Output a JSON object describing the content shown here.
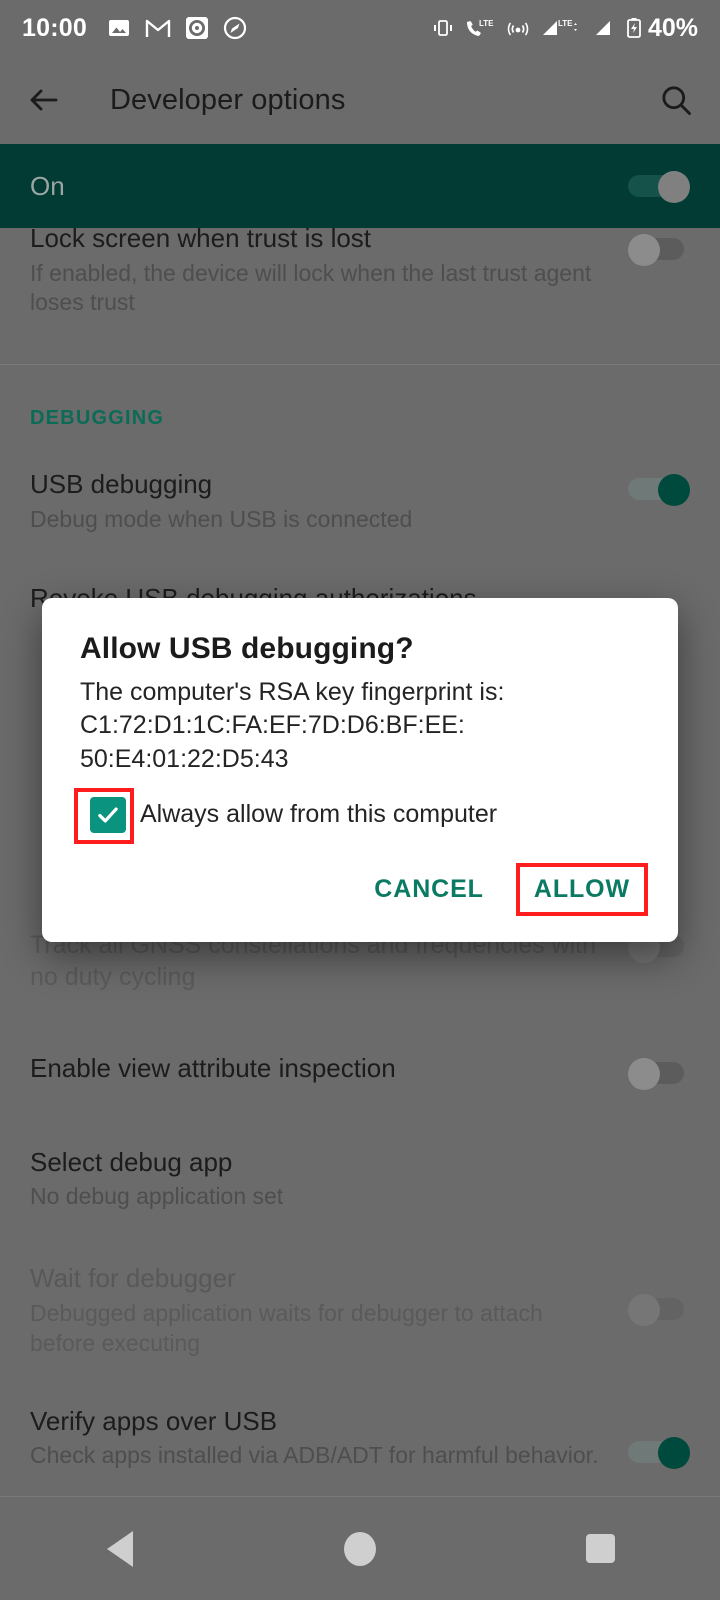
{
  "status_bar": {
    "time": "10:00",
    "battery_percent": "40%",
    "left_icons": [
      "photos-icon",
      "gmail-icon",
      "record-icon",
      "compass-icon"
    ],
    "right_icons": [
      "vibrate-icon",
      "call-lte-icon",
      "hotspot-icon",
      "signal-lte-icon",
      "signal-icon",
      "battery-charging-icon"
    ]
  },
  "app_bar": {
    "back_icon": "back-arrow-icon",
    "title": "Developer options",
    "search_icon": "search-icon"
  },
  "master_switch": {
    "label": "On",
    "state": "on"
  },
  "settings": [
    {
      "id": "lock-screen-when-trust-is-lost",
      "title": "Lock screen when trust is lost",
      "summary": "If enabled, the device will lock when the last trust agent loses trust",
      "control": "switch",
      "state": "off",
      "enabled": true
    }
  ],
  "section_debugging": {
    "header": "DEBUGGING",
    "items": [
      {
        "id": "usb-debugging",
        "title": "USB debugging",
        "summary": "Debug mode when USB is connected",
        "control": "switch",
        "state": "on",
        "enabled": true
      },
      {
        "id": "revoke-usb-debugging-authorizations",
        "title": "Revoke USB debugging authorizations",
        "summary": "",
        "control": "none",
        "state": "",
        "enabled": true
      },
      {
        "id": "track-gnss",
        "title": "",
        "summary": "Track all GNSS constellations and frequencies with no duty cycling",
        "control": "switch",
        "state": "off",
        "enabled": true
      },
      {
        "id": "enable-view-attribute-inspection",
        "title": "Enable view attribute inspection",
        "summary": "",
        "control": "switch",
        "state": "off",
        "enabled": true
      },
      {
        "id": "select-debug-app",
        "title": "Select debug app",
        "summary": "No debug application set",
        "control": "none",
        "state": "",
        "enabled": true
      },
      {
        "id": "wait-for-debugger",
        "title": "Wait for debugger",
        "summary": "Debugged application waits for debugger to attach before executing",
        "control": "switch",
        "state": "off",
        "enabled": false
      },
      {
        "id": "verify-apps-over-usb",
        "title": "Verify apps over USB",
        "summary": "Check apps installed via ADB/ADT for harmful behavior.",
        "control": "switch",
        "state": "on",
        "enabled": true
      }
    ]
  },
  "dialog": {
    "title": "Allow USB debugging?",
    "message_line1": "The computer's RSA key fingerprint is:",
    "message_line2": "C1:72:D1:1C:FA:EF:7D:D6:BF:EE:",
    "message_line3": "50:E4:01:22:D5:43",
    "checkbox_label": "Always allow from this computer",
    "checkbox_checked": true,
    "cancel_label": "CANCEL",
    "allow_label": "ALLOW"
  },
  "nav_bar": {
    "back": "back-triangle-icon",
    "home": "home-circle-icon",
    "recents": "recents-square-icon"
  },
  "colors": {
    "accent_teal": "#0a7a63",
    "banner_dark_teal": "#023b33",
    "annotation_red": "#ff1d1d",
    "checkbox_teal": "#0a9480",
    "scrim_grey": "#6b6b6b"
  }
}
